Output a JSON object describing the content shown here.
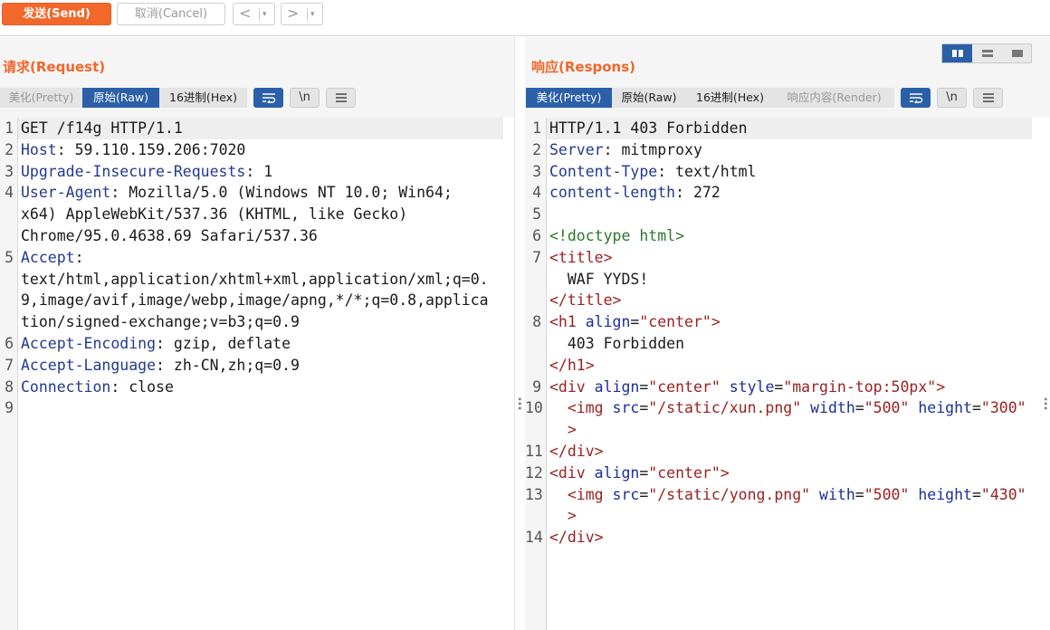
{
  "toolbar": {
    "send_label": "发送(Send)",
    "cancel_label": "取消(Cancel)",
    "back_label": "<",
    "forward_label": ">",
    "drop_glyph": "▾"
  },
  "request": {
    "title": "请求(Request)",
    "tabs": [
      "美化(Pretty)",
      "原始(Raw)",
      "16进制(Hex)"
    ],
    "active_tab": "原始(Raw)",
    "tools": [
      "\\n"
    ],
    "lines": [
      {
        "n": "1",
        "text": "GET /f14g HTTP/1.1"
      },
      {
        "n": "2",
        "key": "Host",
        "val": " 59.110.159.206:7020"
      },
      {
        "n": "3",
        "key": "Upgrade-Insecure-Requests",
        "val": " 1"
      },
      {
        "n": "4",
        "key": "User-Agent",
        "val": " Mozilla/5.0 (Windows NT 10.0; Win64;"
      },
      {
        "n": "",
        "text": "x64) AppleWebKit/537.36 (KHTML, like Gecko)"
      },
      {
        "n": "",
        "text": "Chrome/95.0.4638.69 Safari/537.36"
      },
      {
        "n": "5",
        "key": "Accept",
        "val": ""
      },
      {
        "n": "",
        "text": "text/html,application/xhtml+xml,application/xml;q=0."
      },
      {
        "n": "",
        "text": "9,image/avif,image/webp,image/apng,*/*;q=0.8,applica"
      },
      {
        "n": "",
        "text": "tion/signed-exchange;v=b3;q=0.9"
      },
      {
        "n": "6",
        "key": "Accept-Encoding",
        "val": " gzip, deflate"
      },
      {
        "n": "7",
        "key": "Accept-Language",
        "val": " zh-CN,zh;q=0.9"
      },
      {
        "n": "8",
        "key": "Connection",
        "val": " close"
      },
      {
        "n": "9",
        "text": ""
      }
    ]
  },
  "response": {
    "title": "响应(Respons)",
    "tabs": [
      "美化(Pretty)",
      "原始(Raw)",
      "16进制(Hex)",
      "响应内容(Render)"
    ],
    "active_tab": "美化(Pretty)",
    "tools": [
      "\\n"
    ],
    "lines": [
      {
        "n": "1",
        "text": "HTTP/1.1 403 Forbidden"
      },
      {
        "n": "2",
        "key": "Server",
        "val": " mitmproxy"
      },
      {
        "n": "3",
        "key": "Content-Type",
        "val": " text/html"
      },
      {
        "n": "4",
        "key": "content-length",
        "val": " 272"
      },
      {
        "n": "5",
        "text": ""
      },
      {
        "n": "6",
        "doctype": "<!doctype html>"
      },
      {
        "n": "7",
        "parts": [
          [
            "tag",
            "<title>"
          ]
        ]
      },
      {
        "n": "",
        "parts": [
          [
            "pl",
            "  WAF YYDS!"
          ]
        ]
      },
      {
        "n": "",
        "parts": [
          [
            "tag",
            "</title>"
          ]
        ]
      },
      {
        "n": "8",
        "parts": [
          [
            "tag",
            "<h1 "
          ],
          [
            "attr",
            "align"
          ],
          [
            "pl",
            "="
          ],
          [
            "str",
            "\"center\""
          ],
          [
            "tag",
            ">"
          ]
        ]
      },
      {
        "n": "",
        "parts": [
          [
            "pl",
            "  403 Forbidden"
          ]
        ]
      },
      {
        "n": "",
        "parts": [
          [
            "tag",
            "</h1>"
          ]
        ]
      },
      {
        "n": "9",
        "parts": [
          [
            "tag",
            "<div "
          ],
          [
            "attr",
            "align"
          ],
          [
            "pl",
            "="
          ],
          [
            "str",
            "\"center\""
          ],
          [
            "pl",
            " "
          ],
          [
            "attr",
            "style"
          ],
          [
            "pl",
            "="
          ],
          [
            "str",
            "\"margin-top:50px\""
          ],
          [
            "tag",
            ">"
          ]
        ]
      },
      {
        "n": "10",
        "parts": [
          [
            "tag",
            "  <img "
          ],
          [
            "attr",
            "src"
          ],
          [
            "pl",
            "="
          ],
          [
            "str",
            "\"/static/xun.png\""
          ],
          [
            "pl",
            " "
          ],
          [
            "attr",
            "width"
          ],
          [
            "pl",
            "="
          ],
          [
            "str",
            "\"500\""
          ],
          [
            "pl",
            " "
          ],
          [
            "attr",
            "height"
          ],
          [
            "pl",
            "="
          ],
          [
            "str",
            "\"300\""
          ]
        ]
      },
      {
        "n": "",
        "parts": [
          [
            "tag",
            "  >"
          ]
        ]
      },
      {
        "n": "11",
        "parts": [
          [
            "tag",
            "</div>"
          ]
        ]
      },
      {
        "n": "12",
        "parts": [
          [
            "tag",
            "<div "
          ],
          [
            "attr",
            "align"
          ],
          [
            "pl",
            "="
          ],
          [
            "str",
            "\"center\""
          ],
          [
            "tag",
            ">"
          ]
        ]
      },
      {
        "n": "13",
        "parts": [
          [
            "tag",
            "  <img "
          ],
          [
            "attr",
            "src"
          ],
          [
            "pl",
            "="
          ],
          [
            "str",
            "\"/static/yong.png\""
          ],
          [
            "pl",
            " "
          ],
          [
            "attr",
            "with"
          ],
          [
            "pl",
            "="
          ],
          [
            "str",
            "\"500\""
          ],
          [
            "pl",
            " "
          ],
          [
            "attr",
            "height"
          ],
          [
            "pl",
            "="
          ],
          [
            "str",
            "\"430\""
          ]
        ]
      },
      {
        "n": "",
        "parts": [
          [
            "tag",
            "  >"
          ]
        ]
      },
      {
        "n": "14",
        "parts": [
          [
            "tag",
            "</div>"
          ]
        ]
      }
    ]
  },
  "colors": {
    "accent": "#f2672a",
    "active_tab": "#2b5fa8"
  },
  "icons": {
    "wrap": "wrap-lines-icon",
    "menu": "hamburger-menu-icon",
    "layout": [
      "layout-split-vertical-icon",
      "layout-split-horizontal-icon",
      "layout-single-icon"
    ]
  }
}
